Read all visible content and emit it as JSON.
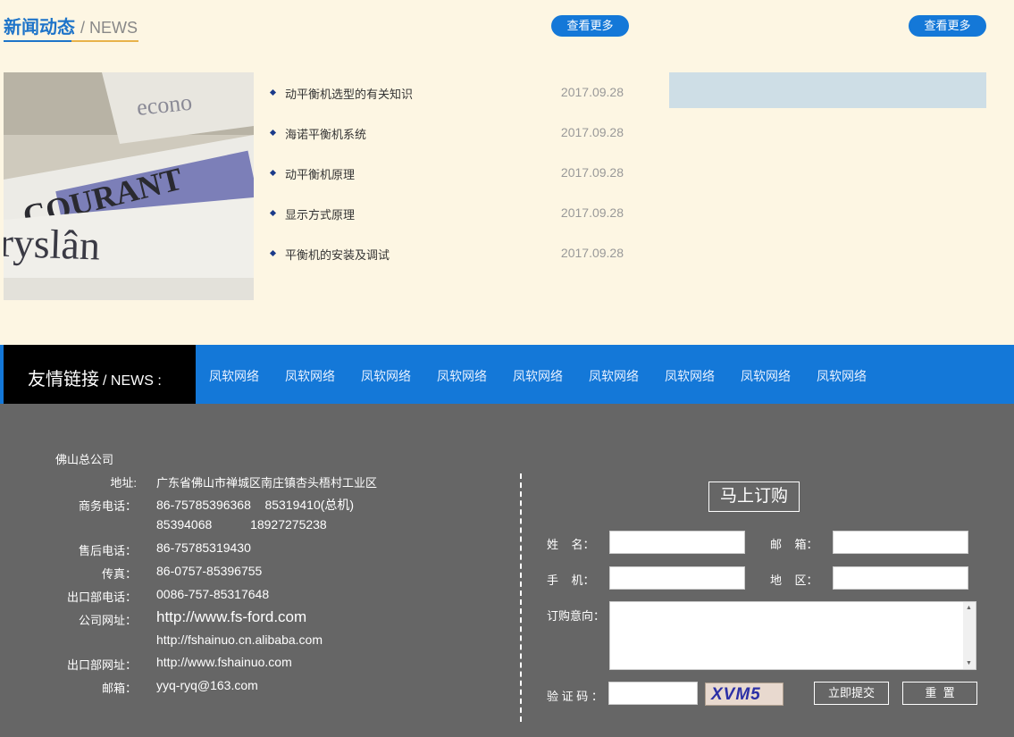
{
  "news": {
    "title": "新闻动态",
    "subtitle": "/ NEWS",
    "more1": "查看更多",
    "more2": "查看更多",
    "items": [
      {
        "title": "动平衡机选型的有关知识",
        "date": "2017.09.28"
      },
      {
        "title": "海诺平衡机系统",
        "date": "2017.09.28"
      },
      {
        "title": "动平衡机原理",
        "date": "2017.09.28"
      },
      {
        "title": "显示方式原理",
        "date": "2017.09.28"
      },
      {
        "title": "平衡机的安装及调试",
        "date": "2017.09.28"
      }
    ]
  },
  "links": {
    "label": "友情链接",
    "sub": "/ NEWS :",
    "items": [
      "凤软网络",
      "凤软网络",
      "凤软网络",
      "凤软网络",
      "凤软网络",
      "凤软网络",
      "凤软网络",
      "凤软网络",
      "凤软网络"
    ]
  },
  "footer": {
    "company": "佛山总公司",
    "address_label": "地址:",
    "address": "广东省佛山市禅城区南庄镇杏头梧村工业区",
    "biz_tel_label": "商务电话：",
    "biz_tel_1": "86-75785396368    85319410(总机)",
    "biz_tel_2": "85394068           18927275238",
    "after_tel_label": "售后电话：",
    "after_tel": "86-75785319430",
    "fax_label": "传真：",
    "fax": "86-0757-85396755",
    "export_tel_label": "出口部电话：",
    "export_tel": "0086-757-85317648",
    "site_label": "公司网址：",
    "site_1": "http://www.fs-ford.com",
    "site_2": "http://fshainuo.cn.alibaba.com",
    "export_site_label": "出口部网址：",
    "export_site": "http://www.fshainuo.com",
    "email_label": "邮箱：",
    "email": "yyq-ryq@163.com"
  },
  "order": {
    "title": "马上订购",
    "name_label": "姓    名：",
    "email_label": "邮    箱：",
    "phone_label": "手    机：",
    "region_label": "地    区：",
    "intent_label": "订购意向：",
    "captcha_label": "验 证 码 ：",
    "captcha_text": "XVM5",
    "submit": "立即提交",
    "reset": "重  置"
  }
}
